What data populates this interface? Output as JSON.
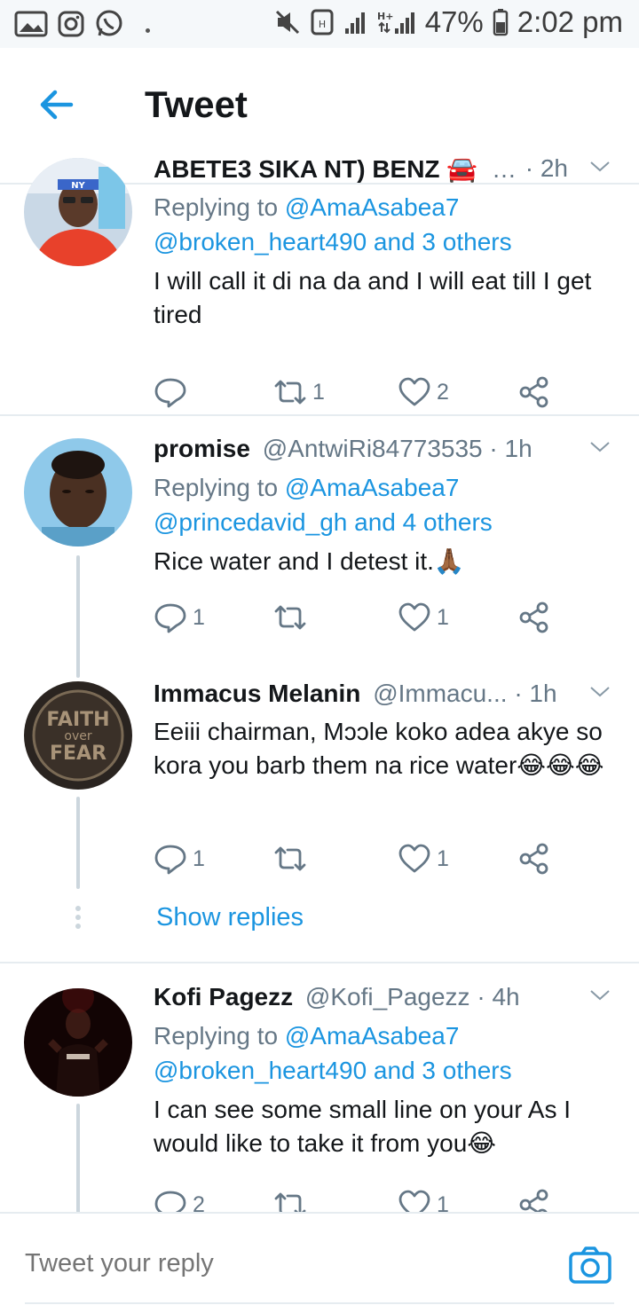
{
  "status_bar": {
    "battery": "47%",
    "time": "2:02 pm",
    "left_icons": [
      "gallery-icon",
      "instagram-icon",
      "whatsapp-icon"
    ],
    "right_icons": [
      "mute-icon",
      "nfc-icon",
      "signal-icon",
      "ht-signal-icon",
      "battery-icon"
    ]
  },
  "header": {
    "title": "Tweet"
  },
  "tweets": [
    {
      "name": "ABETE3 SIKA NT) BENZ 🚘",
      "handle": "…",
      "time": "2h",
      "replying_prefix": "Replying to ",
      "replying_to": "@AmaAsabea7",
      "replying_more": "@broken_heart490 and 3 others",
      "text": "I will call it di na da and I will eat till I get tired",
      "reply_count": "",
      "retweet_count": "1",
      "like_count": "2"
    },
    {
      "name": "promise",
      "handle": "@AntwiRi84773535",
      "time": "1h",
      "replying_prefix": "Replying to ",
      "replying_to": "@AmaAsabea7",
      "replying_more": "@princedavid_gh and 4 others",
      "text": "Rice water and I detest it.🙏🏾",
      "reply_count": "1",
      "retweet_count": "",
      "like_count": "1"
    },
    {
      "name": "Immacus Melanin",
      "handle": "@Immacu...",
      "time": "1h",
      "avatar_text": [
        "FAITH",
        "over",
        "FEAR"
      ],
      "text": "Eeiii chairman, Mɔɔle koko adea akye so kora you barb them na rice water😂😂😂",
      "reply_count": "1",
      "retweet_count": "",
      "like_count": "1",
      "show_replies": "Show replies"
    },
    {
      "name": "Kofi Pagezz",
      "handle": "@Kofi_Pagezz",
      "time": "4h",
      "replying_prefix": "Replying to ",
      "replying_to": "@AmaAsabea7",
      "replying_more": "@broken_heart490 and 3 others",
      "text": "I can see some small line on your As I would like to take it from you😂",
      "reply_count": "2",
      "retweet_count": "",
      "like_count": "1"
    }
  ],
  "reply_bar": {
    "placeholder": "Tweet your reply"
  },
  "colors": {
    "accent": "#1b95e0",
    "muted": "#657786",
    "divider": "#e6ecf0"
  }
}
